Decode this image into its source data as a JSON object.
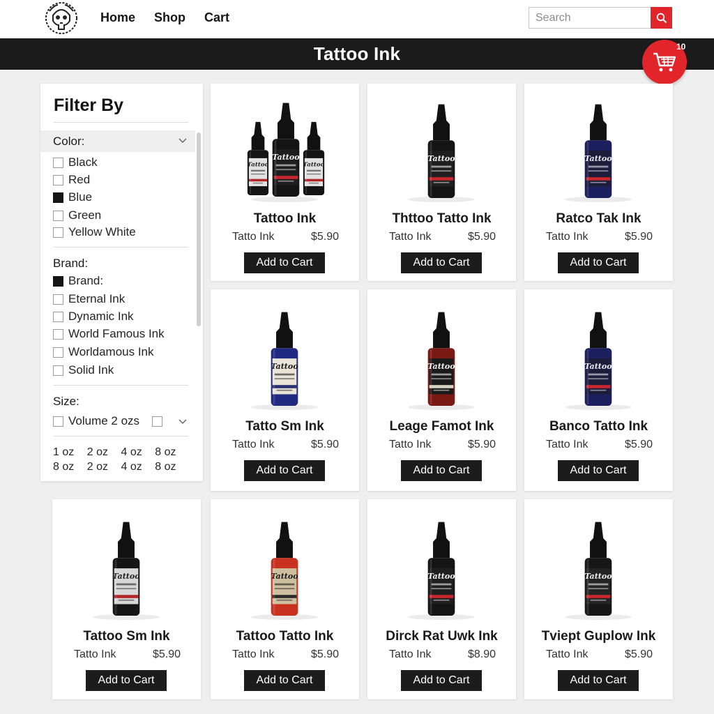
{
  "nav": {
    "links": [
      "Home",
      "Shop",
      "Cart"
    ],
    "search_placeholder": "Search"
  },
  "header": {
    "title": "Tattoo Ink",
    "cart_count": "10"
  },
  "colors": {
    "accent": "#e2242b",
    "dark": "#1b1b1b"
  },
  "filter": {
    "title": "Filter By",
    "color": {
      "label": "Color:",
      "options": [
        {
          "label": "Black",
          "checked": false
        },
        {
          "label": "Red",
          "checked": false
        },
        {
          "label": "Blue",
          "checked": true
        },
        {
          "label": "Green",
          "checked": false
        },
        {
          "label": "Yellow White",
          "checked": false
        }
      ]
    },
    "brand": {
      "label": "Brand:",
      "options": [
        {
          "label": "Brand:",
          "checked": true
        },
        {
          "label": "Eternal Ink",
          "checked": false
        },
        {
          "label": "Dynamic Ink",
          "checked": false
        },
        {
          "label": "World Famous Ink",
          "checked": false
        },
        {
          "label": "Worldamous Ink",
          "checked": false
        },
        {
          "label": "Solid Ink",
          "checked": false
        }
      ]
    },
    "size": {
      "label": "Size:",
      "select_label": "Volume 2 ozs",
      "chips": [
        "1 oz",
        "2 oz",
        "4 oz",
        "8 oz",
        "8 oz",
        "2 oz",
        "4 oz",
        "8 oz"
      ]
    }
  },
  "products": [
    {
      "name": "Tattoo Ink",
      "brand": "Tatto Ink",
      "price": "$5.90",
      "button": "Add to Cart",
      "bottle": "trio"
    },
    {
      "name": "Thttoo Tatto Ink",
      "brand": "Tatto Ink",
      "price": "$5.90",
      "button": "Add to Cart",
      "bottle": "black"
    },
    {
      "name": "Ratco Tak Ink",
      "brand": "Tatto Ink",
      "price": "$5.90",
      "button": "Add to Cart",
      "bottle": "blue"
    },
    {
      "name": "Tatto Sm Ink",
      "brand": "Tatto Ink",
      "price": "$5.90",
      "button": "Add to Cart",
      "bottle": "blue-label"
    },
    {
      "name": "Leage Famot Ink",
      "brand": "Tatto Ink",
      "price": "$5.90",
      "button": "Add to Cart",
      "bottle": "red"
    },
    {
      "name": "Banco Tatto Ink",
      "brand": "Tatto Ink",
      "price": "$5.90",
      "button": "Add to Cart",
      "bottle": "blue"
    },
    {
      "name": "Tattoo Sm Ink",
      "brand": "Tatto Ink",
      "price": "$5.90",
      "button": "Add to Cart",
      "bottle": "black-silver"
    },
    {
      "name": "Tattoo Tatto Ink",
      "brand": "Tatto Ink",
      "price": "$5.90",
      "button": "Add to Cart",
      "bottle": "red-camo"
    },
    {
      "name": "Dirck Rat Uwk Ink",
      "brand": "Tatto Ink",
      "price": "$8.90",
      "button": "Add to Cart",
      "bottle": "black"
    },
    {
      "name": "Tviept Guplow Ink",
      "brand": "Tatto Ink",
      "price": "$5.90",
      "button": "Add to Cart",
      "bottle": "black-emblem"
    }
  ]
}
